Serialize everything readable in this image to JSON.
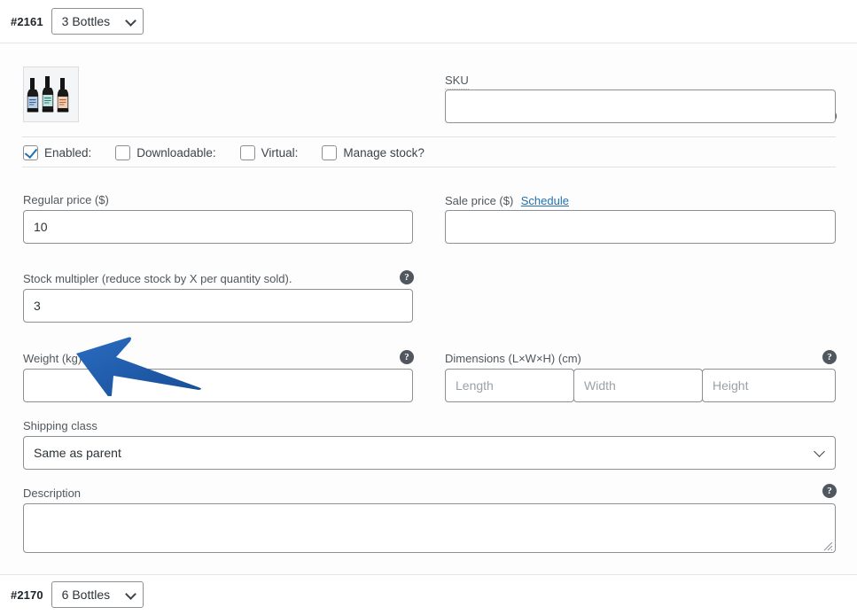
{
  "variations": [
    {
      "id": "#2161",
      "selected_option": "3 Bottles",
      "options": [
        "3 Bottles",
        "6 Bottles"
      ]
    },
    {
      "id": "#2170",
      "selected_option": "6 Bottles",
      "options": [
        "3 Bottles",
        "6 Bottles"
      ]
    }
  ],
  "variation_panel": {
    "thumbnail_alt": "three-wine-bottles-thumbnail",
    "sku": {
      "label": "SKU",
      "value": "",
      "help": "?"
    },
    "checkboxes": [
      {
        "label": "Enabled:",
        "checked": true
      },
      {
        "label": "Downloadable:",
        "checked": false
      },
      {
        "label": "Virtual:",
        "checked": false
      },
      {
        "label": "Manage stock?",
        "checked": false
      }
    ],
    "regular_price": {
      "label": "Regular price ($)",
      "value": "10"
    },
    "sale_price": {
      "label": "Sale price ($)",
      "schedule_link": "Schedule",
      "value": ""
    },
    "stock_multiplier": {
      "label": "Stock multipler (reduce stock by X per quantity sold).",
      "value": "3",
      "help": "?"
    },
    "weight": {
      "label": "Weight (kg)",
      "value": "",
      "help": "?"
    },
    "dimensions": {
      "label": "Dimensions (L×W×H) (cm)",
      "help": "?",
      "fields": [
        {
          "placeholder": "Length",
          "value": ""
        },
        {
          "placeholder": "Width",
          "value": ""
        },
        {
          "placeholder": "Height",
          "value": ""
        }
      ]
    },
    "shipping_class": {
      "label": "Shipping class",
      "selected_option": "Same as parent",
      "options": [
        "Same as parent"
      ]
    },
    "description": {
      "label": "Description",
      "value": "",
      "help": "?"
    }
  },
  "annotation": {
    "type": "arrow",
    "color": "#1c5bab",
    "points_to": "stock-multiplier-input"
  },
  "colors": {
    "accent_blue": "#2271b1",
    "arrow_blue": "#1c5bab",
    "border_grey": "#8c8f94",
    "label_grey": "#50575e",
    "panel_bg": "#fdfdfd"
  }
}
